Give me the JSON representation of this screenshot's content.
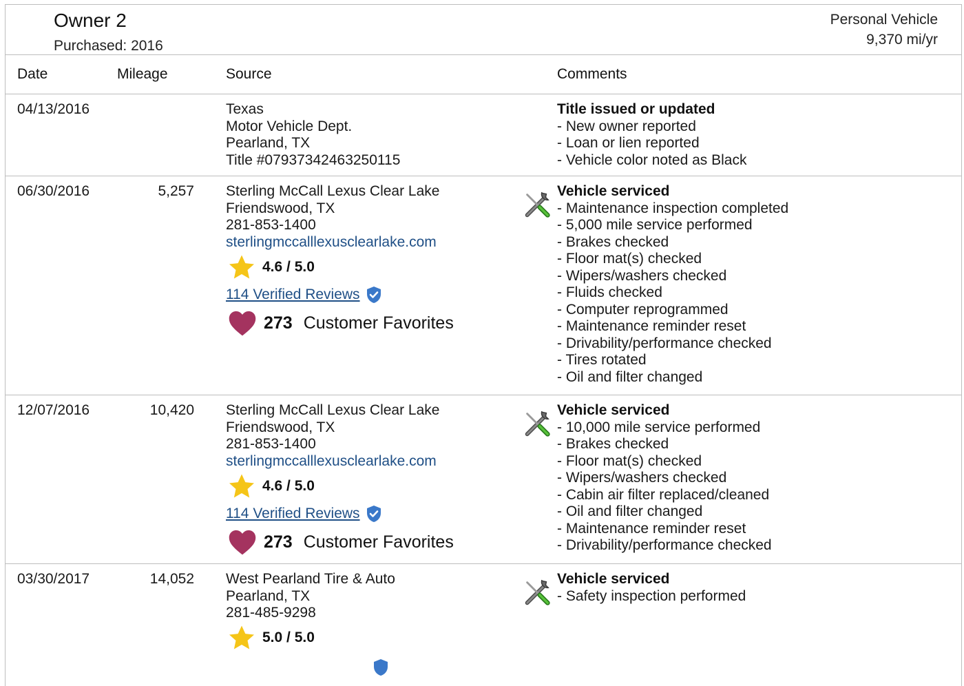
{
  "owner": {
    "title": "Owner 2",
    "purchased": "Purchased: 2016",
    "usage_type": "Personal Vehicle",
    "usage_miles": "9,370 mi/yr"
  },
  "table": {
    "headers": [
      "Date",
      "Mileage",
      "Source",
      "Comments"
    ]
  },
  "rows": [
    {
      "date": "04/13/2016",
      "mileage": "",
      "source": [
        "Texas",
        "Motor Vehicle Dept.",
        "Pearland, TX",
        "Title #07937342463250115"
      ],
      "comment_head": "Title issued or updated",
      "comments": [
        "- New owner reported",
        "- Loan or lien reported",
        "- Vehicle color noted as Black"
      ],
      "icon": "none"
    },
    {
      "date": "06/30/2016",
      "mileage": "5,257",
      "source": [
        "Sterling McCall Lexus Clear Lake",
        "Friendswood, TX",
        "281-853-1400"
      ],
      "website": "sterlingmccalllexusclearlake.com",
      "rating": "4.6 / 5.0",
      "reviews": "114 Verified Reviews",
      "favorites_count": "273",
      "favorites_label": "Customer Favorites",
      "icon": "wrench-screwdriver-icon",
      "comment_head": "Vehicle serviced",
      "comments": [
        "- Maintenance inspection completed",
        "- 5,000 mile service performed",
        "- Brakes checked",
        "- Floor mat(s) checked",
        "- Wipers/washers checked",
        "- Fluids checked",
        "- Computer reprogrammed",
        "- Maintenance reminder reset",
        "- Drivability/performance checked",
        "- Tires rotated",
        "- Oil and filter changed"
      ]
    },
    {
      "date": "12/07/2016",
      "mileage": "10,420",
      "source": [
        "Sterling McCall Lexus Clear Lake",
        "Friendswood, TX",
        "281-853-1400"
      ],
      "website": "sterlingmccalllexusclearlake.com",
      "rating": "4.6 / 5.0",
      "reviews": "114 Verified Reviews",
      "favorites_count": "273",
      "favorites_label": "Customer Favorites",
      "icon": "wrench-screwdriver-icon",
      "comment_head": "Vehicle serviced",
      "comments": [
        "- 10,000 mile service performed",
        "- Brakes checked",
        "- Floor mat(s) checked",
        "- Wipers/washers checked",
        "- Cabin air filter replaced/cleaned",
        "- Oil and filter changed",
        "- Maintenance reminder reset",
        "- Drivability/performance checked"
      ]
    },
    {
      "date": "03/30/2017",
      "mileage": "14,052",
      "source": [
        "West Pearland Tire & Auto",
        "Pearland, TX",
        "281-485-9298"
      ],
      "rating": "5.0 / 5.0",
      "icon": "wrench-screwdriver-icon",
      "comment_head": "Vehicle serviced",
      "comments": [
        "- Safety inspection performed"
      ]
    }
  ],
  "colors": {
    "link": "#1f4f86",
    "star": "#f5c518",
    "heart": "#a4335f",
    "shield": "#3a78c9",
    "border": "#bdbdbd"
  }
}
